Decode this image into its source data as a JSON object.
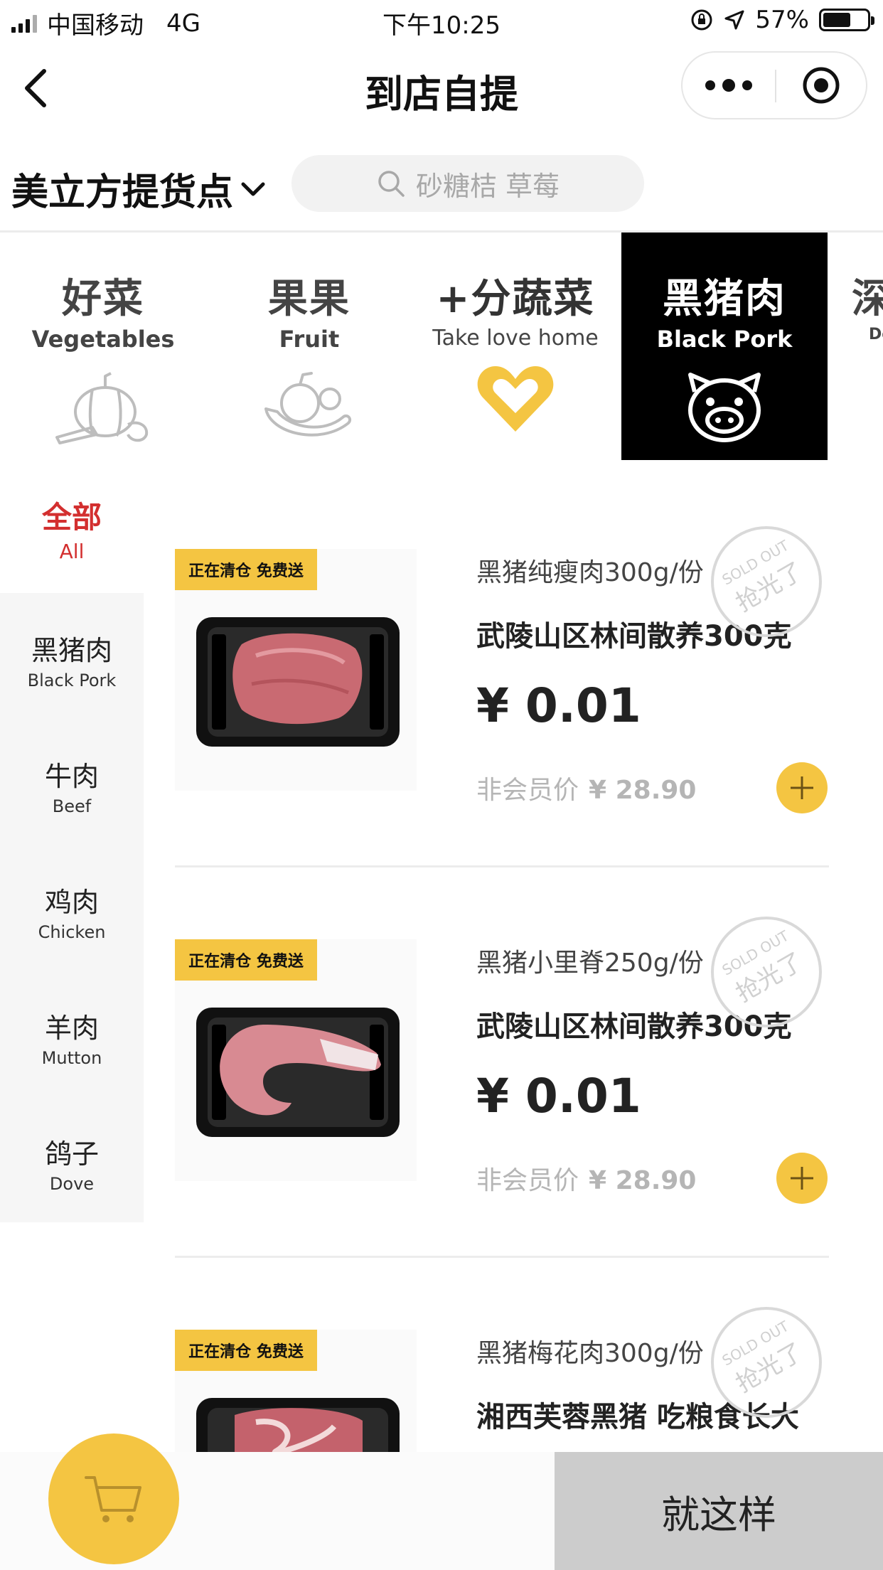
{
  "status_bar": {
    "carrier": "中国移动",
    "network": "4G",
    "time": "下午10:25",
    "battery": "57%",
    "battery_level": 0.57
  },
  "navbar": {
    "title": "到店自提"
  },
  "store": {
    "name": "美立方提货点"
  },
  "search": {
    "placeholder": "砂糖桔 草莓"
  },
  "categories": [
    {
      "cn": "好菜",
      "en": "Vegetables",
      "icon": "pumpkin-icon",
      "active": false
    },
    {
      "cn": "果果",
      "en": "Fruit",
      "icon": "fruit-icon",
      "active": false
    },
    {
      "cn": "+分蔬菜",
      "en": "Take love home",
      "icon": "heart-icon",
      "active": false
    },
    {
      "cn": "黑猪肉",
      "en": "Black Pork",
      "icon": "pig-icon",
      "active": true
    },
    {
      "cn": "深",
      "en": "De",
      "icon": "",
      "active": false
    }
  ],
  "sidebar": {
    "all": {
      "cn": "全部",
      "en": "All"
    },
    "items": [
      {
        "cn": "黑猪肉",
        "en": "Black Pork"
      },
      {
        "cn": "牛肉",
        "en": "Beef"
      },
      {
        "cn": "鸡肉",
        "en": "Chicken"
      },
      {
        "cn": "羊肉",
        "en": "Mutton"
      },
      {
        "cn": "鸽子",
        "en": "Dove"
      }
    ]
  },
  "products": [
    {
      "badge": "正在清仓 免费送",
      "spec": "黑猪纯瘦肉300g/份",
      "name": "武陵山区林间散养300克",
      "price": "¥ 0.01",
      "orig_label": "非会员价",
      "orig_price": "¥ 28.90",
      "stamp_top": "SOLD OUT",
      "stamp_main": "抢光了"
    },
    {
      "badge": "正在清仓 免费送",
      "spec": "黑猪小里脊250g/份",
      "name": "武陵山区林间散养300克",
      "price": "¥ 0.01",
      "orig_label": "非会员价",
      "orig_price": "¥ 28.90",
      "stamp_top": "SOLD OUT",
      "stamp_main": "抢光了"
    },
    {
      "badge": "正在清仓 免费送",
      "spec": "黑猪梅花肉300g/份",
      "name": "湘西芙蓉黑猪 吃粮食长大",
      "price": "",
      "orig_label": "",
      "orig_price": "",
      "stamp_top": "SOLD OUT",
      "stamp_main": "抢光了"
    }
  ],
  "bottom_bar": {
    "checkout_label": "就这样"
  },
  "colors": {
    "accent": "#f4c542",
    "active_red": "#d32f2f",
    "active_tile": "#000000",
    "checkout_bg": "#cccccc"
  }
}
